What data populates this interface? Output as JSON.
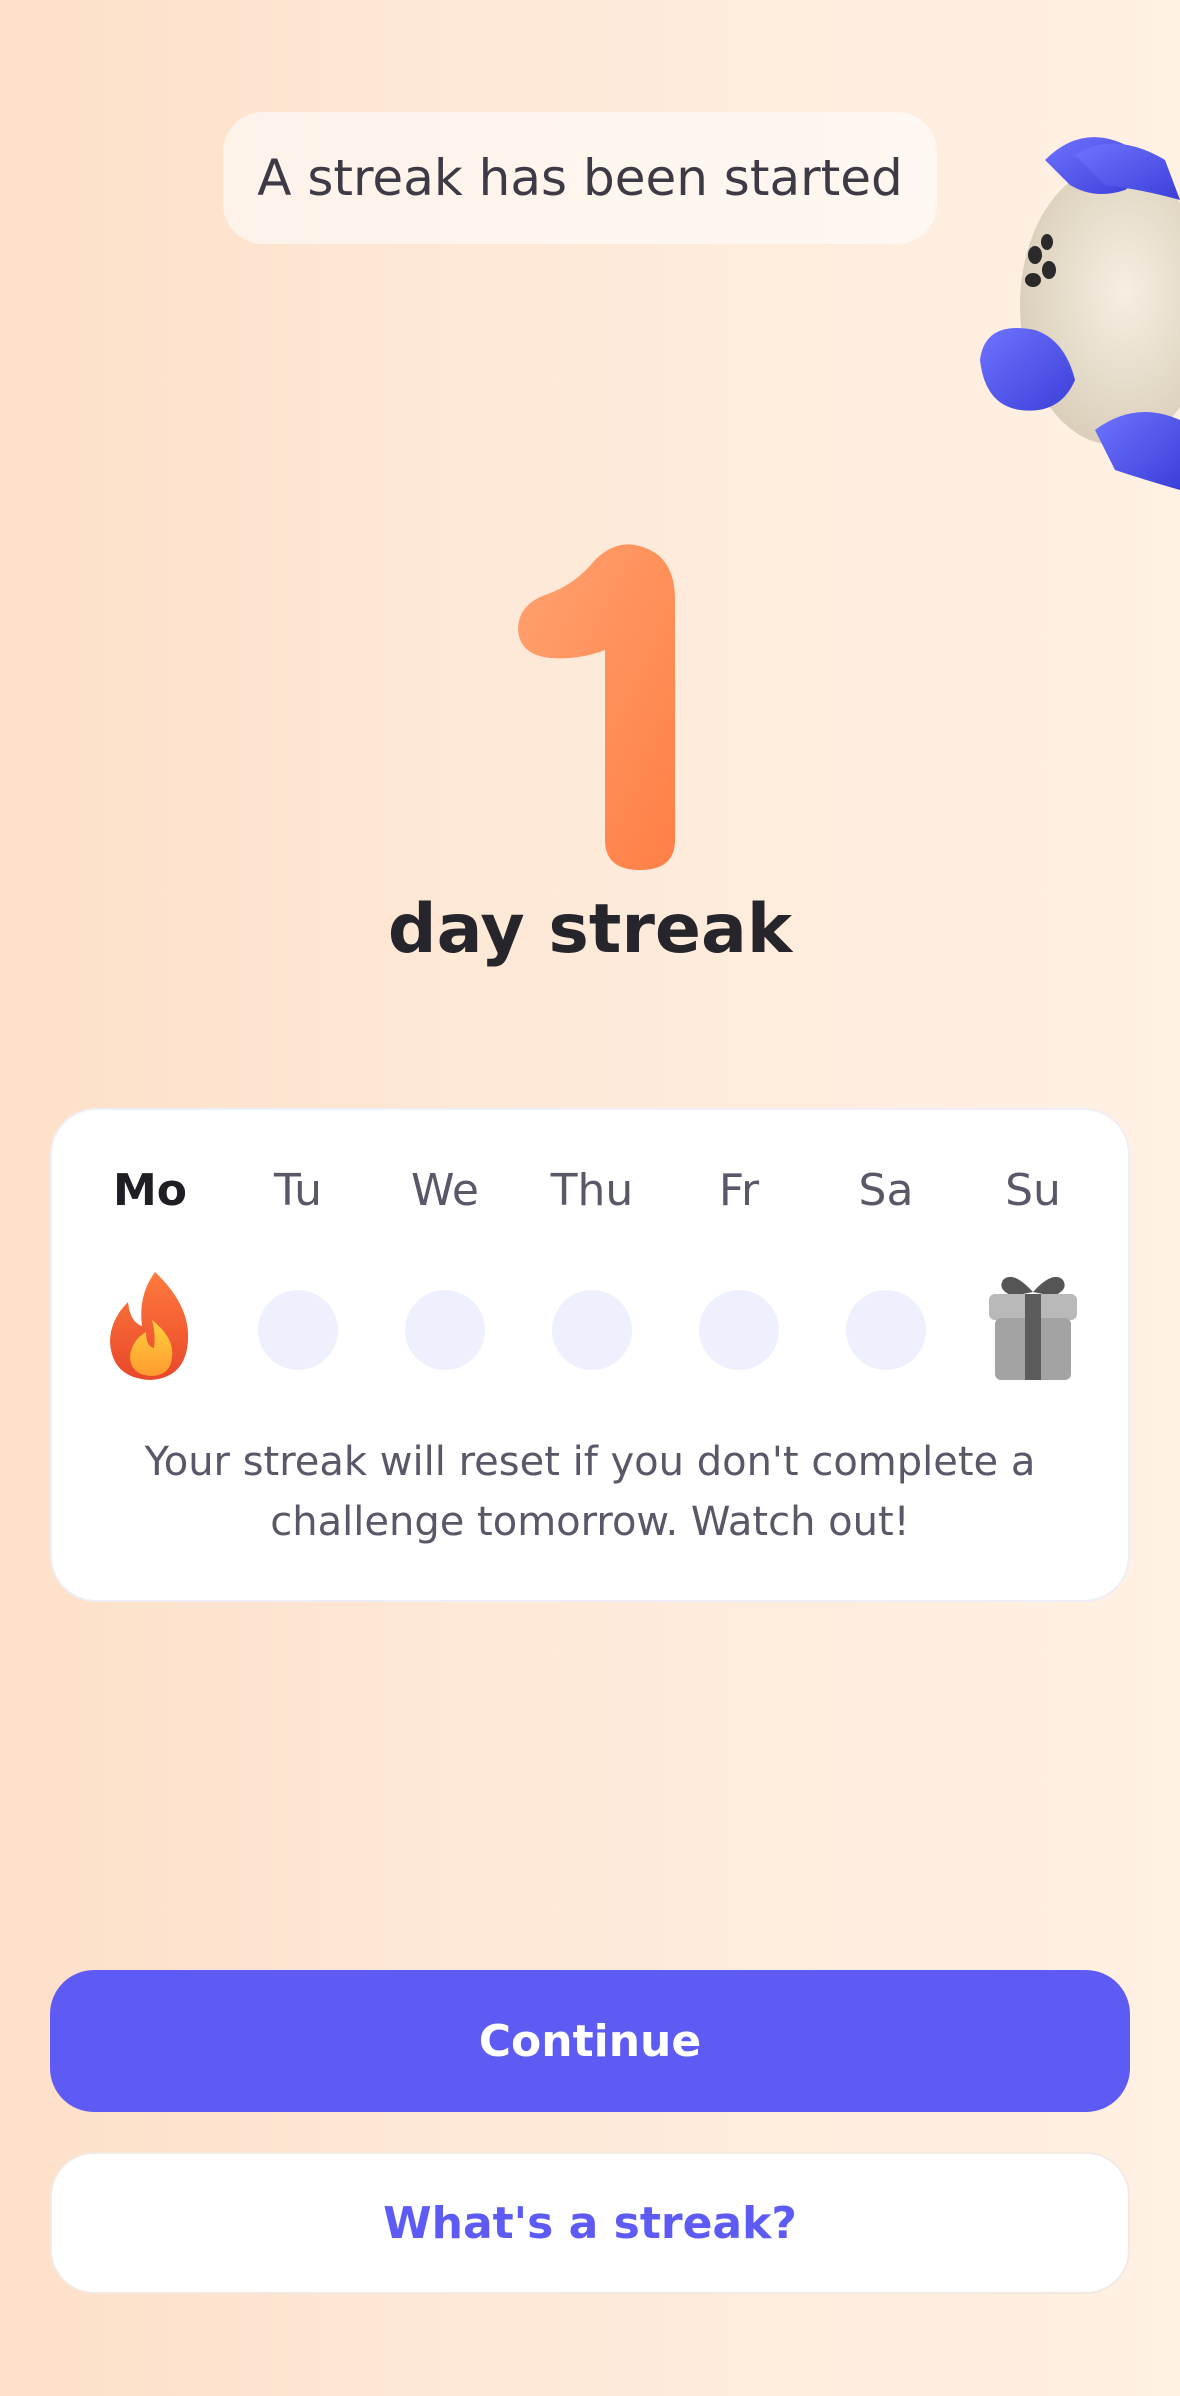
{
  "header": {
    "banner_text": "A streak has been started"
  },
  "streak": {
    "count": "1",
    "label": "day streak"
  },
  "week": {
    "days": [
      {
        "label": "Mo",
        "state": "completed",
        "icon": "fire-icon"
      },
      {
        "label": "Tu",
        "state": "empty"
      },
      {
        "label": "We",
        "state": "empty"
      },
      {
        "label": "Thu",
        "state": "empty"
      },
      {
        "label": "Fr",
        "state": "empty"
      },
      {
        "label": "Sa",
        "state": "empty"
      },
      {
        "label": "Su",
        "state": "reward",
        "icon": "gift-icon"
      }
    ],
    "note": "Your streak will reset if you don't complete a challenge tomorrow. Watch out!"
  },
  "actions": {
    "continue_label": "Continue",
    "whats_streak_label": "What's a streak?"
  },
  "colors": {
    "accent": "#5e5bf4",
    "number": "#ff8a52",
    "empty_dot": "#eef0fd"
  }
}
